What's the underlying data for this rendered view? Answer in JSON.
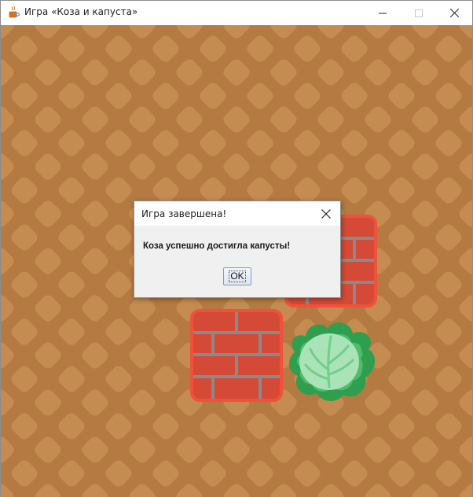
{
  "window": {
    "title": "Игра «Коза и капуста»",
    "icon": "java-cup-icon",
    "controls": [
      "minimize-icon",
      "maximize-icon",
      "close-icon"
    ]
  },
  "board": {
    "background_color": "#b47a42",
    "pattern_color": "#c58c51",
    "grid_size": 5,
    "pieces": [
      {
        "type": "wall",
        "row": 2,
        "col": 3
      },
      {
        "type": "wall",
        "row": 3,
        "col": 2
      },
      {
        "type": "cabbage",
        "row": 3,
        "col": 3
      }
    ]
  },
  "dialog": {
    "title": "Игра завершена!",
    "message": "Коза успешно достигла капусты!",
    "ok_label": "OK"
  },
  "colors": {
    "brick": "#d44a37",
    "brick_border": "#f0513c",
    "mortar": "#8a8a8a",
    "cabbage_dark": "#2f9e4f",
    "cabbage_light": "#a9e3b7"
  }
}
